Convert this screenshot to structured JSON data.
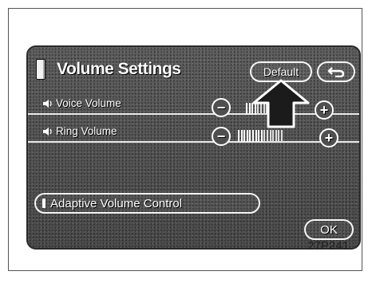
{
  "screen": {
    "title": "Volume Settings",
    "buttons": {
      "default_label": "Default",
      "back_icon": "return-arrow-icon",
      "ok_label": "OK"
    },
    "rows": [
      {
        "label": "Voice Volume",
        "icon": "speaker-icon",
        "level_fraction": 0.25,
        "bars": 16
      },
      {
        "label": "Ring Volume",
        "icon": "speaker-icon",
        "level_fraction": 0.56,
        "bars": 16
      }
    ],
    "adaptive": {
      "label": "Adaptive Volume Control",
      "indicator_on": true
    },
    "controls": {
      "minus": "−",
      "plus": "+"
    }
  },
  "figure_code": "27P241",
  "colors": {
    "screen_bg": "#555555",
    "text": "#ffffff",
    "indicator_arrow": "#1a1a1a"
  }
}
